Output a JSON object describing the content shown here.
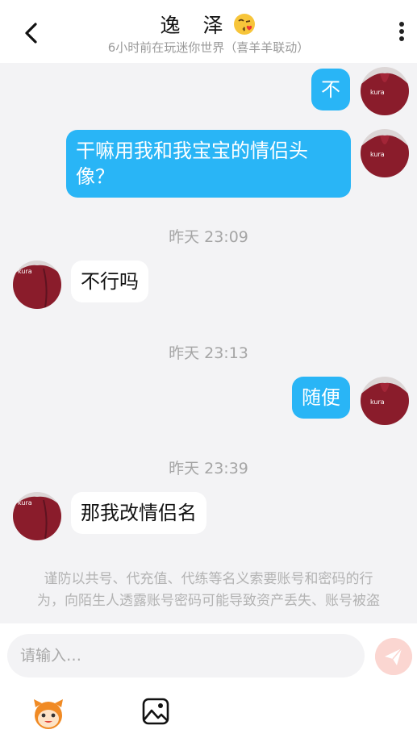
{
  "header": {
    "title": "逸 泽",
    "subtitle": "6小时前在玩迷你世界（喜羊羊联动）"
  },
  "messages": [
    {
      "side": "out",
      "text": "不"
    },
    {
      "side": "out",
      "text": "干嘛用我和我宝宝的情侣头像？"
    },
    {
      "time": "昨天 23:09"
    },
    {
      "side": "in",
      "text": "不行吗"
    },
    {
      "time": "昨天 23:13"
    },
    {
      "side": "out",
      "text": "随便"
    },
    {
      "time": "昨天 23:39"
    },
    {
      "side": "in",
      "text": "那我改情侣名"
    }
  ],
  "notice": "谨防以共号、代充值、代练等名义索要账号和密码的行为，向陌生人透露账号密码可能导致资产丢失、账号被盗",
  "input": {
    "placeholder": "请输入…"
  },
  "avatar_text": "kura",
  "colors": {
    "out_bubble": "#29b5f6",
    "send_button": "#fbd6d1"
  }
}
